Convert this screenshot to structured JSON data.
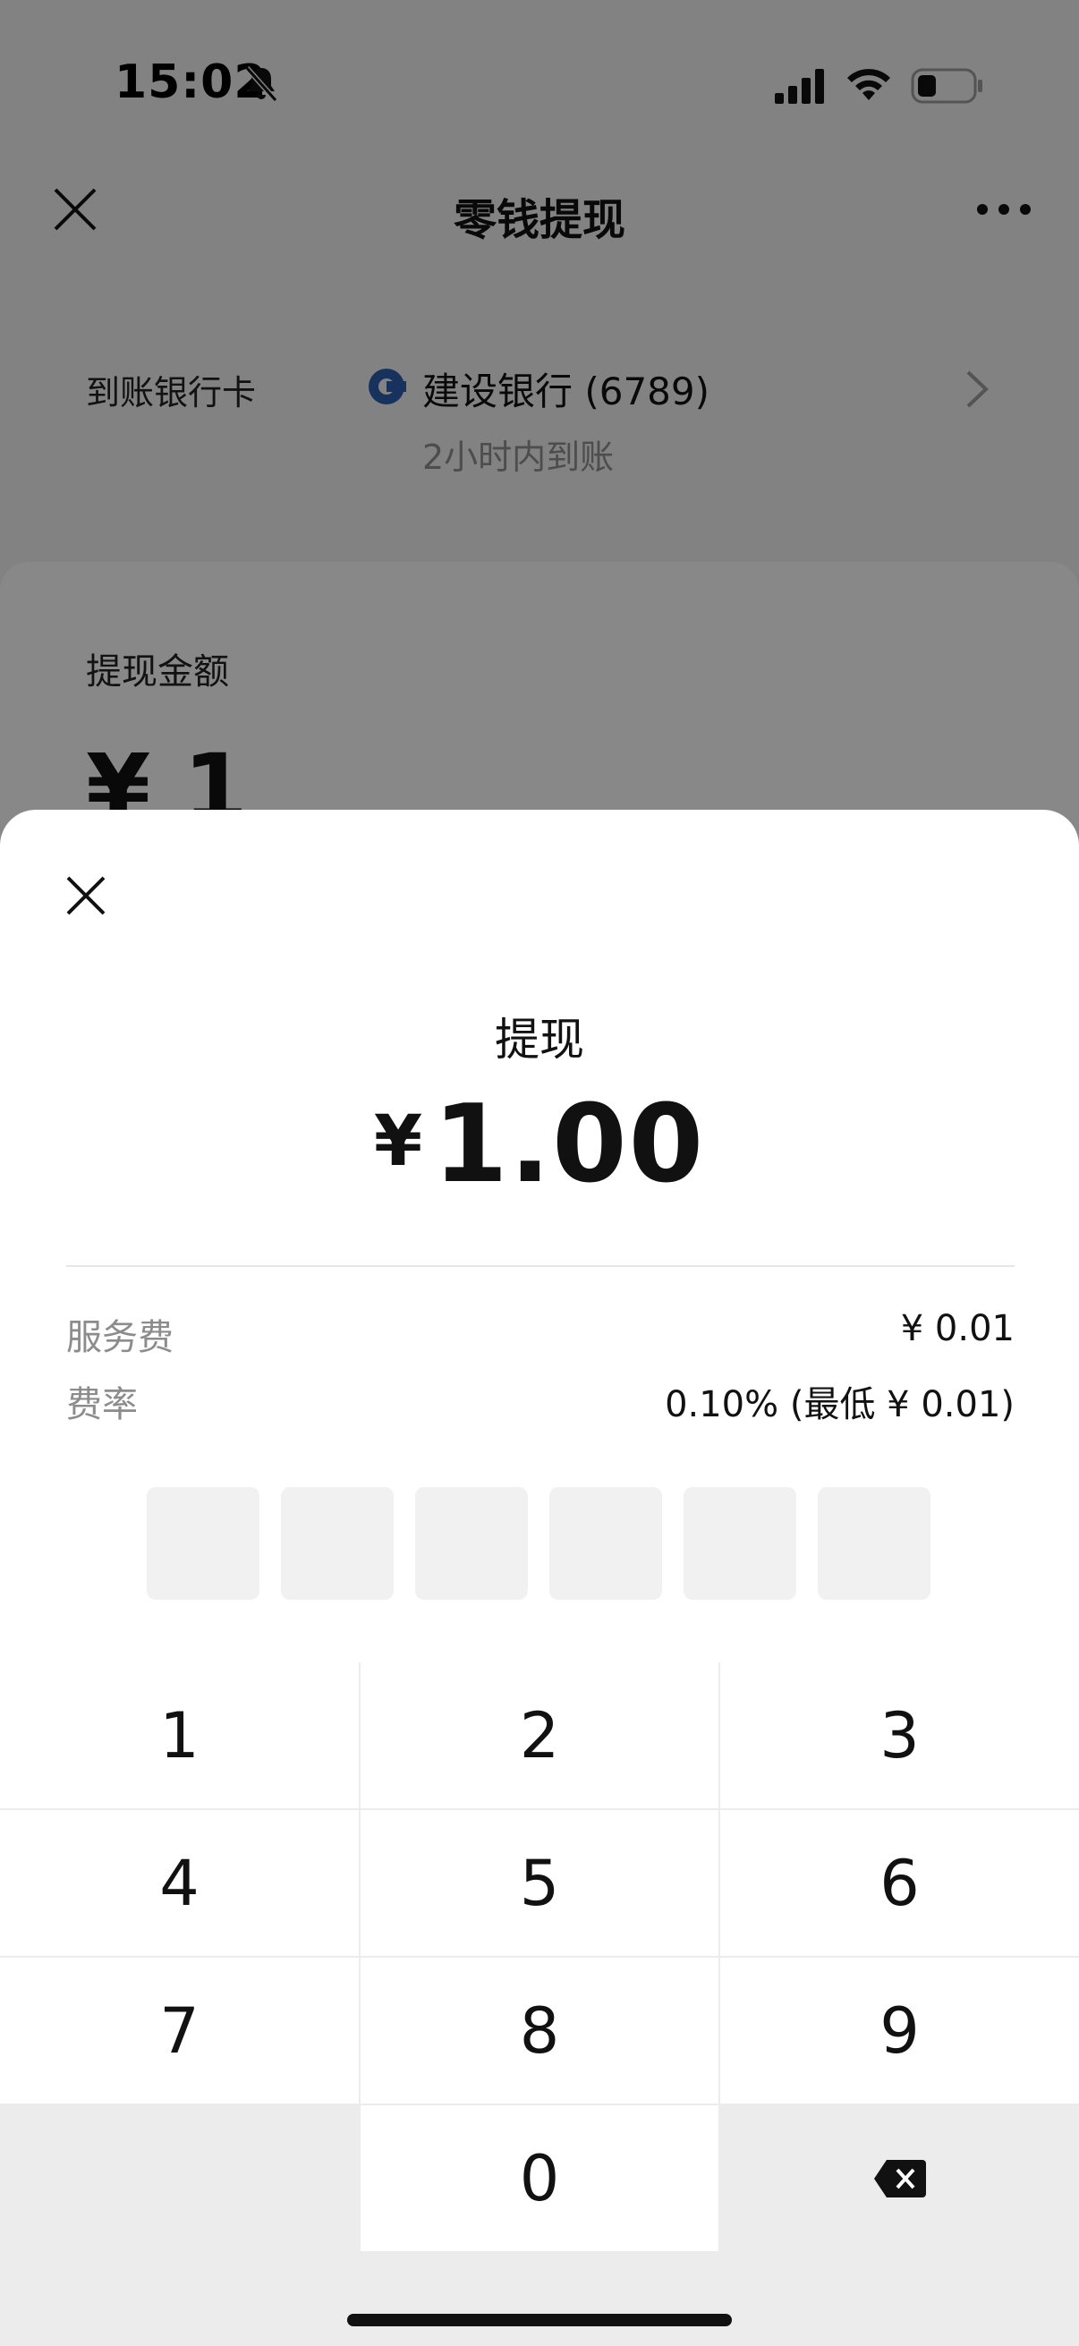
{
  "status_bar": {
    "time": "15:02"
  },
  "nav": {
    "title": "零钱提现"
  },
  "bank": {
    "label": "到账银行卡",
    "name": "建设银行 (6789)",
    "arrival": "2小时内到账"
  },
  "amount_card": {
    "label": "提现金额",
    "value": "¥ 1"
  },
  "sheet": {
    "title": "提现",
    "currency": "¥",
    "amount": "1.00",
    "fee_label": "服务费",
    "fee_value": "¥ 0.01",
    "rate_label": "费率",
    "rate_value": "0.10% (最低 ¥ 0.01)"
  },
  "keypad": {
    "keys": [
      "1",
      "2",
      "3",
      "4",
      "5",
      "6",
      "7",
      "8",
      "9",
      "0"
    ]
  },
  "colors": {
    "overlay": "#000000",
    "sheet": "#ffffff",
    "keypad_bg": "#ececec"
  }
}
